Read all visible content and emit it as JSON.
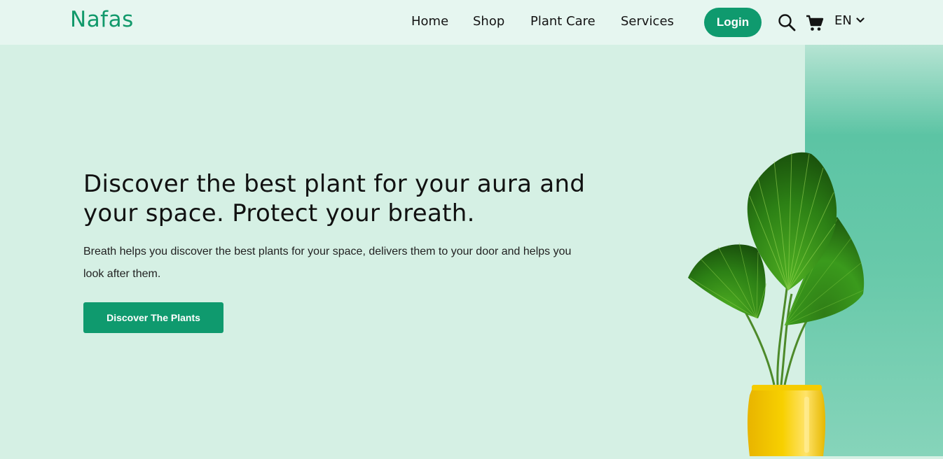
{
  "brand": {
    "logo_text": "Nafas"
  },
  "nav": {
    "links": [
      {
        "label": "Home"
      },
      {
        "label": "Shop"
      },
      {
        "label": "Plant Care"
      },
      {
        "label": "Services"
      }
    ],
    "login_label": "Login",
    "language": "EN",
    "icons": {
      "search": "search-icon",
      "cart": "cart-icon",
      "dropdown": "chevron-down-icon"
    }
  },
  "hero": {
    "title": "Discover the best plant for your aura and your space. Protect your breath.",
    "description": "Breath helps you discover the best plants for your space, delivers them to your door and helps you look after them.",
    "cta_label": "Discover The Plants"
  },
  "colors": {
    "brand_green": "#0f9a6e",
    "hero_background": "#d5f0e4",
    "navbar_background": "#e6f6f0",
    "accent_panel": "#5cc4a4",
    "pot_yellow": "#f2c400"
  }
}
